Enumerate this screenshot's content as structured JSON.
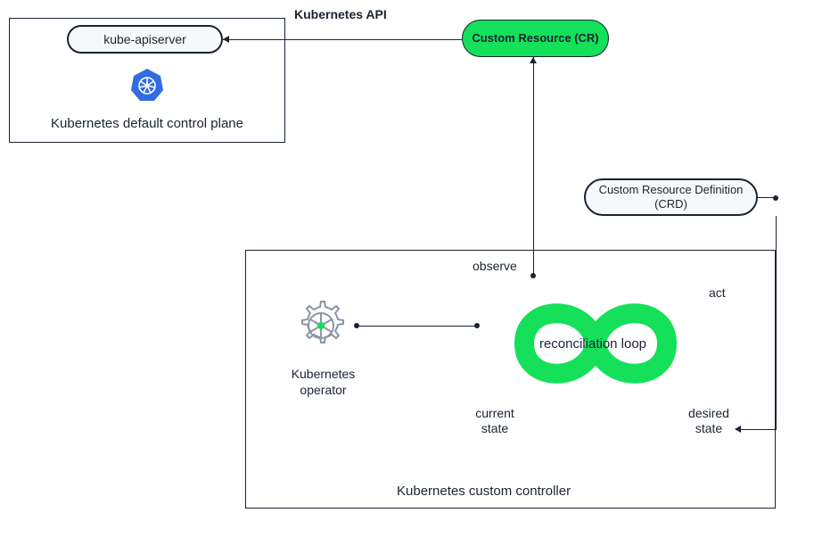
{
  "control_plane": {
    "apiserver": "kube-apiserver",
    "label": "Kubernetes default control plane"
  },
  "api_edge_label": "Kubernetes API",
  "cr_pill": "Custom Resource (CR)",
  "crd_pill": "Custom Resource Definition (CRD)",
  "controller": {
    "label": "Kubernetes custom controller",
    "operator": "Kubernetes operator",
    "loop": {
      "center": "reconciliation loop",
      "observe": "observe",
      "act": "act",
      "current": "current state",
      "desired": "desired state"
    }
  },
  "colors": {
    "accent_green": "#14e05a",
    "ink": "#1a2332",
    "k8s_blue": "#326ce5"
  }
}
